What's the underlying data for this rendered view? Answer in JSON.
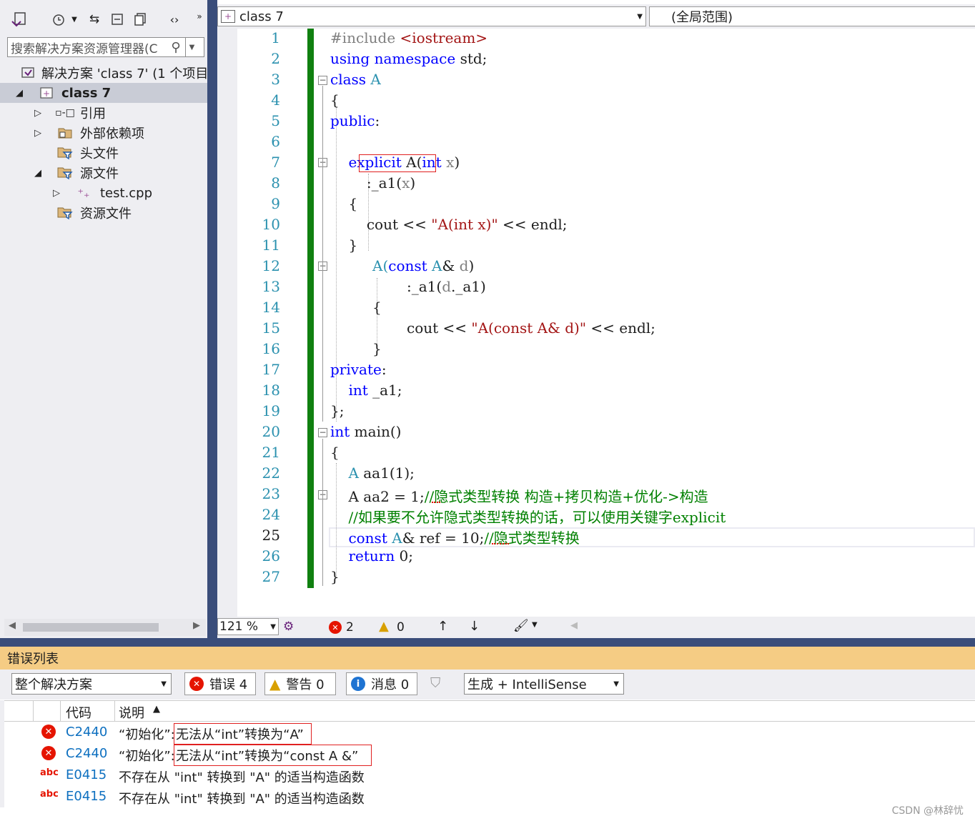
{
  "solution_explorer": {
    "search_placeholder": "搜索解决方案资源管理器(C",
    "items": [
      {
        "label": "解决方案 'class 7' (1 个项目,",
        "icon": "solution-icon"
      },
      {
        "label": "class 7",
        "icon": "project-icon"
      },
      {
        "label": "引用",
        "icon": "references-icon"
      },
      {
        "label": "外部依赖项",
        "icon": "external-deps-icon"
      },
      {
        "label": "头文件",
        "icon": "filter-folder-icon"
      },
      {
        "label": "源文件",
        "icon": "filter-folder-icon"
      },
      {
        "label": "test.cpp",
        "icon": "cpp-file-icon"
      },
      {
        "label": "资源文件",
        "icon": "filter-folder-icon"
      }
    ]
  },
  "editor": {
    "project_dropdown": "class 7",
    "scope_dropdown": "(全局范围)",
    "line_numbers": [
      "1",
      "2",
      "3",
      "4",
      "5",
      "6",
      "7",
      "8",
      "9",
      "10",
      "11",
      "12",
      "13",
      "14",
      "15",
      "16",
      "17",
      "18",
      "19",
      "20",
      "21",
      "22",
      "23",
      "24",
      "25",
      "26",
      "27"
    ],
    "current_line": "25",
    "code": {
      "l1a": "#include ",
      "l1b": "<iostream>",
      "l2a": "using namespace",
      "l2b": " std;",
      "l3a": "class",
      "l3b": " A",
      "l4": "{",
      "l5a": "public",
      "l5b": ":",
      "l7a": "explicit",
      "l7b": " A(",
      "l7c": "int",
      "l7d": " x",
      "l7e": ")",
      "l8a": ":_a1(",
      "l8b": "x",
      "l8c": ")",
      "l9": "{",
      "l10a": "cout << ",
      "l10b": "\"A(int x)\"",
      "l10c": " << endl;",
      "l11": "}",
      "l12a": "A(",
      "l12b": "const",
      "l12c": " A",
      "l12d": "& ",
      "l12e": "d",
      "l12f": ")",
      "l13a": ":_a1(",
      "l13b": "d",
      "l13c": "._a1)",
      "l14": "{",
      "l15a": "cout << ",
      "l15b": "\"A(const A& d)\"",
      "l15c": " << endl;",
      "l16": "}",
      "l17a": "private",
      "l17b": ":",
      "l18a": "int",
      "l18b": " _a1;",
      "l19": "};",
      "l20a": "int",
      "l20b": " main()",
      "l21": "{",
      "l22a": "A",
      "l22b": " aa1(1);",
      "l23a": "A aa2 = 1;",
      "l23b": "//隐式类型转换 构造+拷贝构造+优化->构造",
      "l24": "//如果要不允许隐式类型转换的话，可以使用关键字explicit",
      "l25a": "const",
      "l25b": " A",
      "l25c": "& ref = 10;",
      "l25d": "//隐式类型转换",
      "l26a": "return",
      "l26b": " 0;",
      "l27": "}"
    },
    "status": {
      "zoom": "121 %",
      "errors": "2",
      "warnings": "0"
    }
  },
  "error_list": {
    "title": "错误列表",
    "scope": "整个解决方案",
    "errors_btn": "错误 4",
    "warnings_btn": "警告 0",
    "messages_btn": "消息 0",
    "build_filter": "生成 + IntelliSense",
    "col_code": "代码",
    "col_desc": "说明",
    "rows": [
      {
        "type": "error",
        "code": "C2440",
        "desc_a": "“初始化”:",
        "desc_b": "无法从“int”转换为“A”"
      },
      {
        "type": "error",
        "code": "C2440",
        "desc_a": "“初始化”:",
        "desc_b": "无法从“int”转换为“const A &”"
      },
      {
        "type": "intellisense",
        "code": "E0415",
        "desc_a": "不存在从 \"int\" 转换到 \"A\" 的适当构造函数",
        "desc_b": ""
      },
      {
        "type": "intellisense",
        "code": "E0415",
        "desc_a": "不存在从 \"int\" 转换到 \"A\" 的适当构造函数",
        "desc_b": ""
      }
    ]
  },
  "watermark": "CSDN @林辞忧",
  "colors": {
    "keyword": "#0000ff",
    "type": "#2b91af",
    "string": "#a31515",
    "comment": "#008000",
    "change_bar": "#108010",
    "error_panel_title": "#f5cc84"
  }
}
